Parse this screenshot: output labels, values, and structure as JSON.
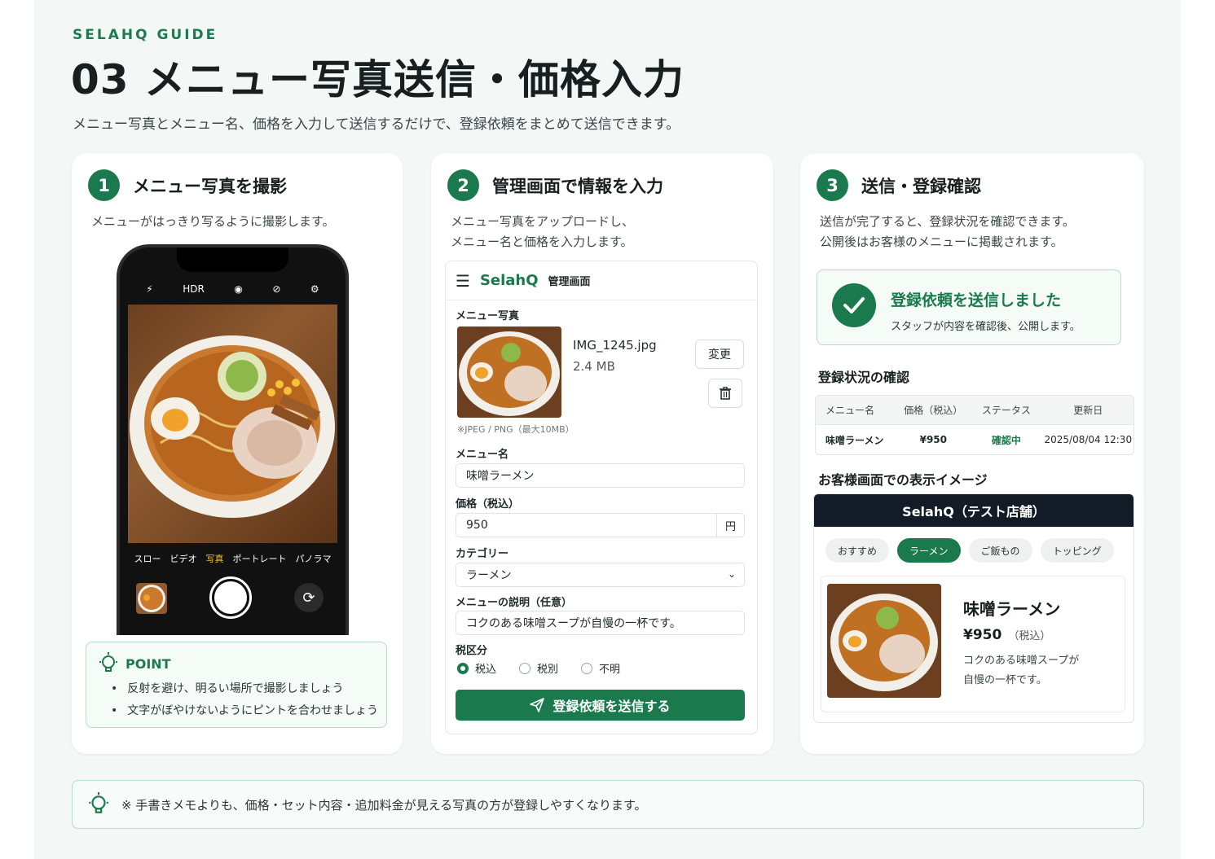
{
  "header": {
    "eyebrow": "SELAHQ GUIDE",
    "title": "03 メニュー写真送信・価格入力",
    "subtitle": "メニュー写真とメニュー名、価格を入力して送信するだけで、登録依頼をまとめて送信できます。"
  },
  "step1": {
    "number": "1",
    "title": "メニュー写真を撮影",
    "desc": "メニューがはっきり写るように撮影します。",
    "camera": {
      "top_label": "HDR",
      "modes": [
        "スロー",
        "ビデオ",
        "写真",
        "ポートレート",
        "パノラマ"
      ],
      "active_mode": "写真"
    },
    "point": {
      "label": "POINT",
      "items": [
        "反射を避け、明るい場所で撮影しましょう",
        "文字がぼやけないようにピントを合わせましょう"
      ]
    }
  },
  "step2": {
    "number": "2",
    "title": "管理画面で情報を入力",
    "desc_line1": "メニュー写真をアップロードし、",
    "desc_line2": "メニュー名と価格を入力します。",
    "admin": {
      "brand": "SelahQ",
      "brand_sub": "管理画面",
      "photo_label": "メニュー写真",
      "file_name": "IMG_1245.jpg",
      "file_size": "2.4 MB",
      "change_button": "変更",
      "file_hint": "※JPEG / PNG（最大10MB）",
      "name_label": "メニュー名",
      "name_value": "味噌ラーメン",
      "price_label": "価格（税込）",
      "price_value": "950",
      "price_unit": "円",
      "category_label": "カテゴリー",
      "category_value": "ラーメン",
      "desc_label": "メニューの説明（任意）",
      "desc_value": "コクのある味噌スープが自慢の一杯です。",
      "tax_label": "税区分",
      "tax_options": [
        "税込",
        "税別",
        "不明"
      ],
      "tax_selected": "税込",
      "submit_label": "登録依頼を送信する"
    }
  },
  "step3": {
    "number": "3",
    "title": "送信・登録確認",
    "desc_line1": "送信が完了すると、登録状況を確認できます。",
    "desc_line2": "公開後はお客様のメニューに掲載されます。",
    "done": {
      "title": "登録依頼を送信しました",
      "sub": "スタッフが内容を確認後、公開します。"
    },
    "status_title": "登録状況の確認",
    "table": {
      "headers": [
        "メニュー名",
        "価格（税込）",
        "ステータス",
        "更新日"
      ],
      "row": [
        "味噌ラーメン",
        "¥950",
        "確認中",
        "2025/08/04 12:30"
      ]
    },
    "preview_title": "お客様画面での表示イメージ",
    "preview": {
      "shop": "SelahQ（テスト店舗）",
      "chips": [
        "おすすめ",
        "ラーメン",
        "ご飯もの",
        "トッピング"
      ],
      "active_chip": "ラーメン",
      "item_name": "味噌ラーメン",
      "item_price": "¥950",
      "item_tax": "（税込）",
      "item_desc_line1": "コクのある味噌スープが",
      "item_desc_line2": "自慢の一杯です。"
    }
  },
  "footer": {
    "note": "※ 手書きメモよりも、価格・セット内容・追加料金が見える写真の方が登録しやすくなります。"
  },
  "colors": {
    "accent": "#1a7a4d",
    "background": "#f3f7f5",
    "dark_bar": "#131c26"
  }
}
